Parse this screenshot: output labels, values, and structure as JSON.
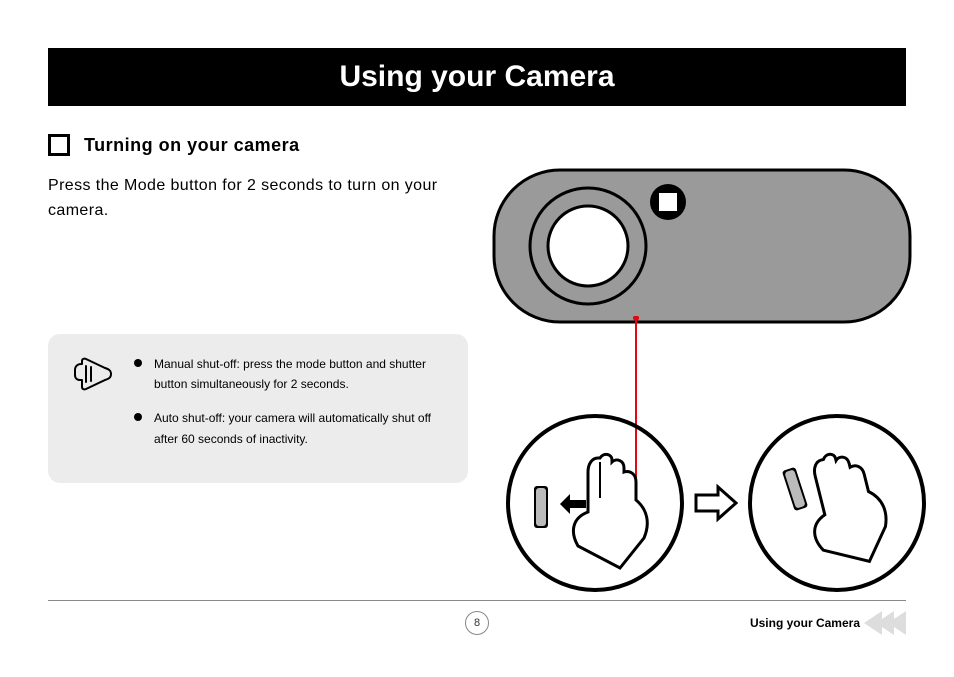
{
  "header": {
    "title": "Using  your Camera"
  },
  "section": {
    "title": "Turning on your camera",
    "body": "Press the Mode button for 2 seconds to turn on your camera."
  },
  "notes": {
    "items": [
      "Manual shut-off: press the mode button and shutter button simultaneously for 2 seconds.",
      "Auto shut-off: your camera will automatically shut off after 60 seconds of inactivity."
    ]
  },
  "footer": {
    "page_number": "8",
    "section_label": "Using your Camera"
  }
}
